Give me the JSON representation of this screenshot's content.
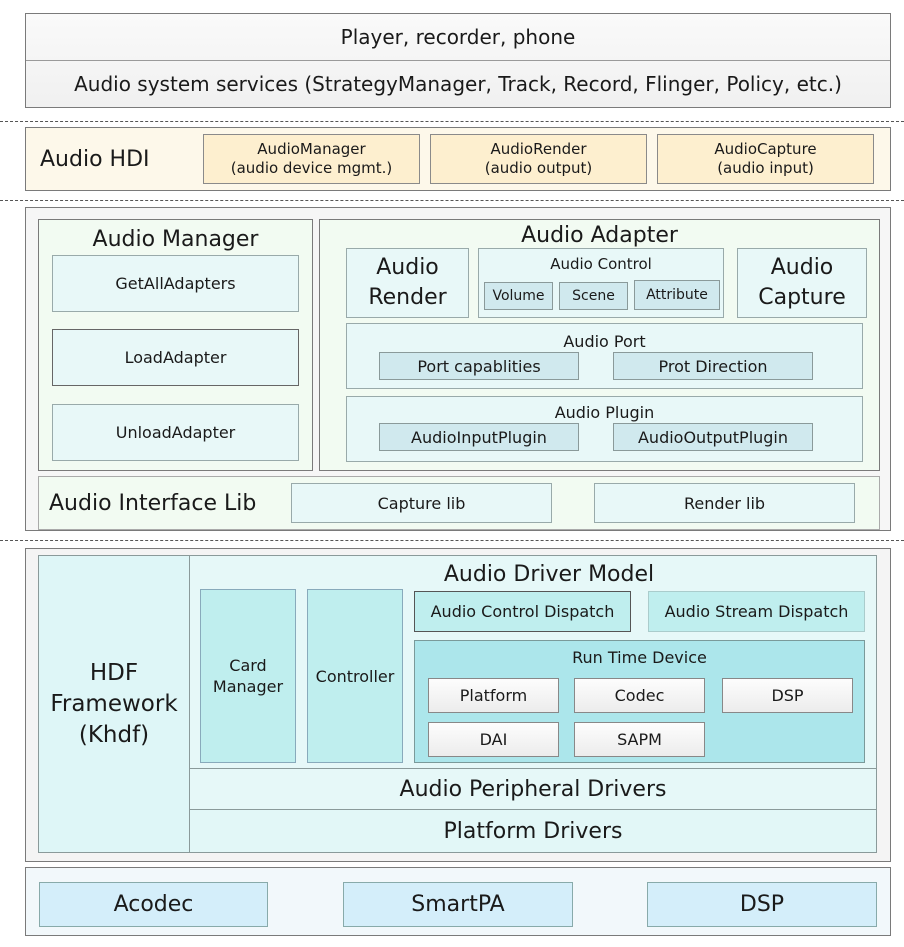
{
  "app_layer": {
    "apps": "Player, recorder, phone",
    "services": "Audio system services (StrategyManager, Track, Record, Flinger, Policy, etc.)"
  },
  "hdi": {
    "title": "Audio HDI",
    "boxes": [
      {
        "name": "AudioManager",
        "desc": "(audio device mgmt.)"
      },
      {
        "name": "AudioRender",
        "desc": "(audio output)"
      },
      {
        "name": "AudioCapture",
        "desc": "(audio input)"
      }
    ]
  },
  "audio_manager": {
    "title": "Audio Manager",
    "items": [
      "GetAllAdapters",
      "LoadAdapter",
      "UnloadAdapter"
    ]
  },
  "audio_adapter": {
    "title": "Audio Adapter",
    "render": "Audio Render",
    "capture": "Audio Capture",
    "control": {
      "title": "Audio Control",
      "items": [
        "Volume",
        "Scene",
        "Attribute"
      ]
    },
    "port": {
      "title": "Audio Port",
      "items": [
        "Port capablities",
        "Prot Direction"
      ]
    },
    "plugin": {
      "title": "Audio Plugin",
      "items": [
        "AudioInputPlugin",
        "AudioOutputPlugin"
      ]
    }
  },
  "interface_lib": {
    "title": "Audio Interface Lib",
    "items": [
      "Capture lib",
      "Render lib"
    ]
  },
  "driver": {
    "hdf": "HDF Framework (Khdf)",
    "hdf_lines": [
      "HDF",
      "Framework",
      "(Khdf)"
    ],
    "model_title": "Audio Driver Model",
    "card_manager_lines": [
      "Card",
      "Manager"
    ],
    "controller": "Controller",
    "control_dispatch": "Audio Control Dispatch",
    "stream_dispatch": "Audio Stream Dispatch",
    "runtime": {
      "title": "Run Time Device",
      "items": [
        "Platform",
        "Codec",
        "DSP",
        "DAI",
        "SAPM"
      ]
    },
    "peripheral": "Audio Peripheral Drivers",
    "platform": "Platform Drivers"
  },
  "hardware": {
    "items": [
      "Acodec",
      "SmartPA",
      "DSP"
    ]
  }
}
